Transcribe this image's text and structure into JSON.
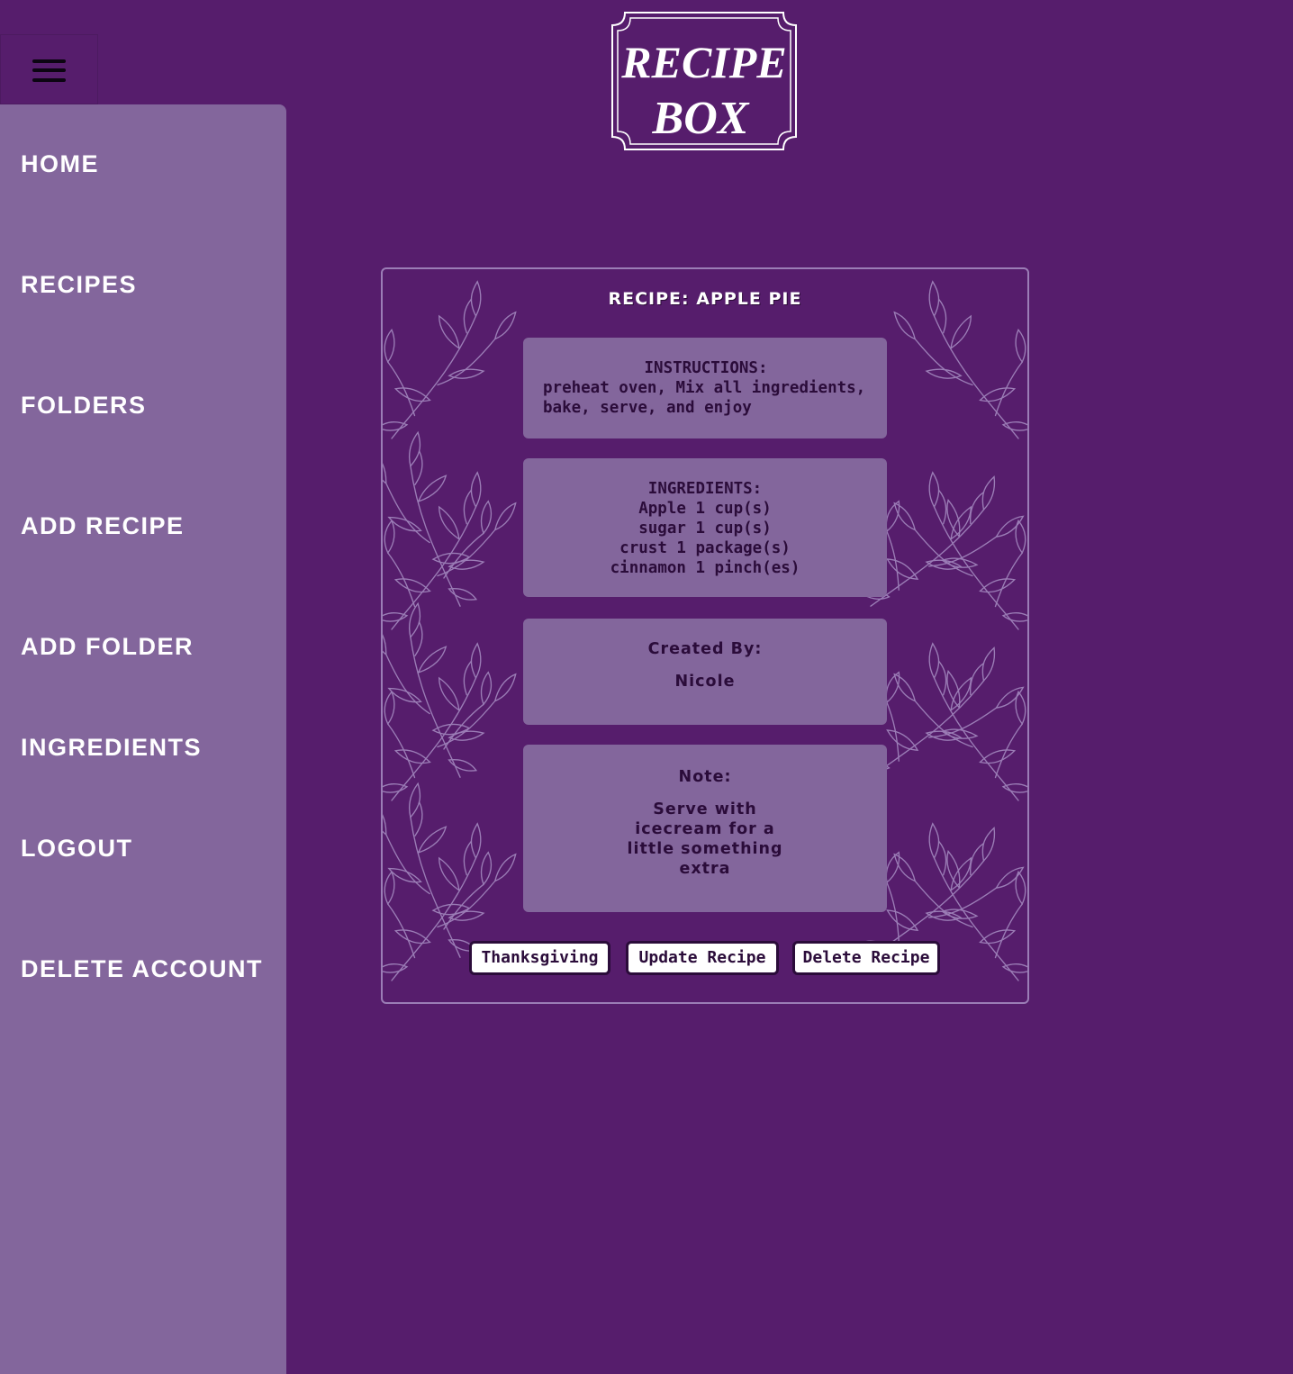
{
  "logo": {
    "line1": "RECIPE",
    "line2": "BOX"
  },
  "menu_icon": "hamburger-menu-icon",
  "sidebar": {
    "items": [
      {
        "label": "HOME"
      },
      {
        "label": "RECIPES"
      },
      {
        "label": "FOLDERS"
      },
      {
        "label": "ADD RECIPE"
      },
      {
        "label": "ADD FOLDER"
      },
      {
        "label": "INGREDIENTS"
      },
      {
        "label": "LOGOUT"
      },
      {
        "label": "DELETE ACCOUNT"
      }
    ]
  },
  "recipe": {
    "title": "RECIPE: APPLE PIE",
    "instructions_label": "INSTRUCTIONS:",
    "instructions": "preheat oven, Mix all ingredients, bake, serve, and enjoy",
    "ingredients_label": "INGREDIENTS:",
    "ingredients": [
      "Apple 1 cup(s)",
      "sugar 1 cup(s)",
      "crust 1 package(s)",
      "cinnamon 1 pinch(es)"
    ],
    "created_by_label": "Created By:",
    "created_by": "Nicole",
    "note_label": "Note:",
    "note": "Serve with icecream for a little something extra"
  },
  "buttons": {
    "folder": "Thanksgiving",
    "update": "Update Recipe",
    "delete": "Delete Recipe"
  },
  "colors": {
    "background": "#561d6c",
    "sidebar": "#83669c",
    "box": "#83669c",
    "text_dark": "#2b0c3a",
    "leaf_stroke": "#9b7db6"
  }
}
